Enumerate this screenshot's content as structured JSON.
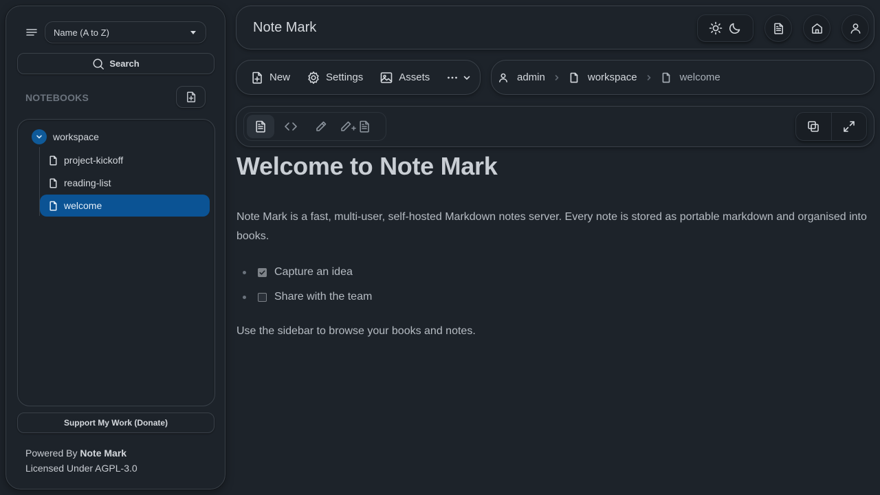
{
  "sidebar": {
    "sort_select": {
      "value": "Name (A to Z)"
    },
    "search_label": "Search",
    "notebooks_heading": "NOTEBOOKS",
    "book": {
      "name": "workspace"
    },
    "notes": [
      {
        "name": "project-kickoff",
        "active": false
      },
      {
        "name": "reading-list",
        "active": false
      },
      {
        "name": "welcome",
        "active": true
      }
    ],
    "donate_label": "Support My Work (Donate)",
    "footer": {
      "powered_prefix": "Powered By",
      "powered_name": "Note Mark",
      "license": "Licensed Under AGPL-3.0"
    }
  },
  "header": {
    "title": "Note Mark",
    "icons": [
      "sun-icon",
      "moon-icon",
      "document-icon",
      "home-icon",
      "user-icon"
    ]
  },
  "actions": {
    "new_label": "New",
    "settings_label": "Settings",
    "assets_label": "Assets"
  },
  "breadcrumb": {
    "user": "admin",
    "book": "workspace",
    "note": "welcome"
  },
  "editor": {
    "modes": [
      "rendered-view-icon",
      "code-icon",
      "pencil-icon",
      "edit-with-preview-icon"
    ],
    "active_mode": "rendered-view-icon"
  },
  "content": {
    "heading": "Welcome to Note Mark",
    "intro": "Note Mark is a fast, multi-user, self-hosted Markdown notes server. Every note is stored as portable markdown and organised into books.",
    "tasks": [
      {
        "text": "Capture an idea",
        "checked": true
      },
      {
        "text": "Share with the team",
        "checked": false
      }
    ],
    "outro": "Use the sidebar to browse your books and notes."
  },
  "colors": {
    "background": "#1d232a",
    "accent": "#0b5394",
    "border": "#3a4149",
    "text": "#c8ccd2"
  }
}
